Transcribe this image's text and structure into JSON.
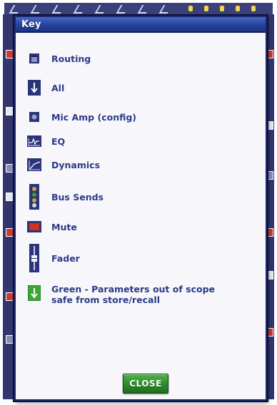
{
  "dialog": {
    "title": "Key",
    "close_label": "CLOSE"
  },
  "key_items": [
    {
      "icon": "routing-icon",
      "label": "Routing"
    },
    {
      "icon": "all-arrow-icon",
      "label": "All"
    },
    {
      "icon": "mic-amp-icon",
      "label": "Mic Amp (config)"
    },
    {
      "icon": "eq-icon",
      "label": "EQ"
    },
    {
      "icon": "dynamics-icon",
      "label": "Dynamics"
    },
    {
      "icon": "bus-sends-icon",
      "label": "Bus Sends"
    },
    {
      "icon": "mute-icon",
      "label": "Mute"
    },
    {
      "icon": "fader-icon",
      "label": "Fader"
    },
    {
      "icon": "safe-green-icon",
      "label_line1": "Green - Parameters out of scope",
      "label_line2": "safe from store/recall"
    }
  ],
  "colors": {
    "label_text": "#2a3a86",
    "icon_navy": "#2b3478",
    "mute_red": "#d2311f",
    "safe_green": "#3fa535",
    "close_green": "#2c8a2a",
    "titlebar_blue": "#24409a"
  }
}
